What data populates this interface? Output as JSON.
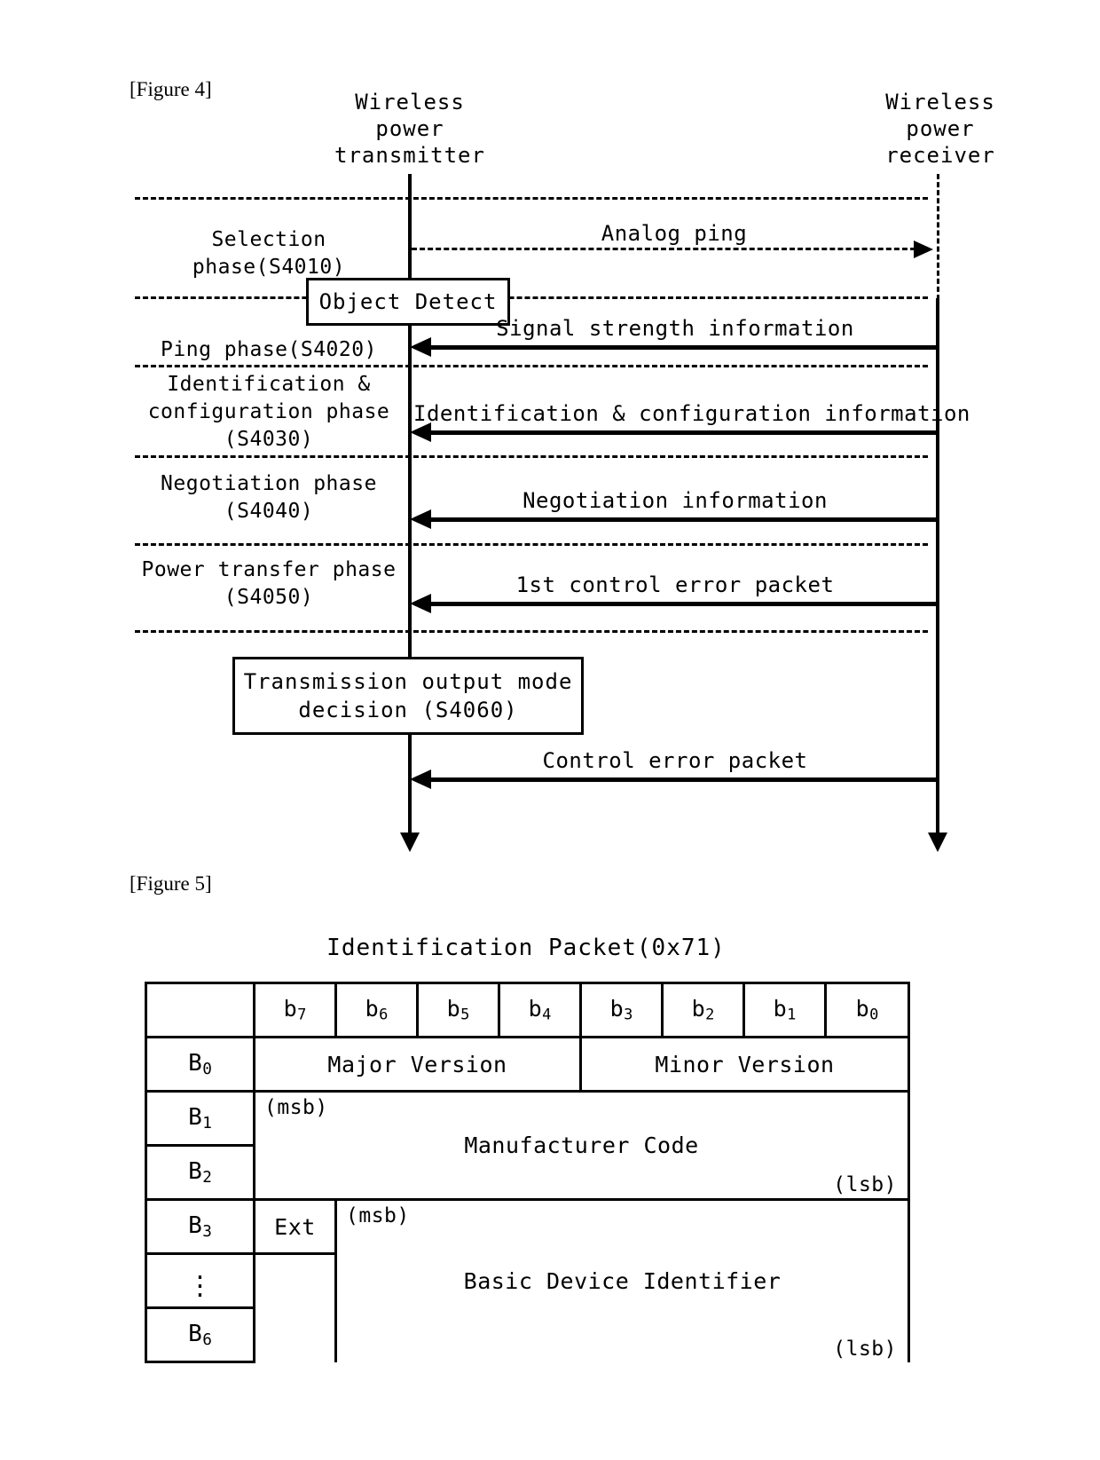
{
  "figure4": {
    "caption": "[Figure 4]",
    "actors": {
      "transmitter": "Wireless\npower\ntransmitter",
      "receiver": "Wireless\npower\nreceiver"
    },
    "phases": [
      {
        "id": "s4010",
        "label": "Selection phase(S4010)"
      },
      {
        "id": "s4020",
        "label": "Ping phase(S4020)"
      },
      {
        "id": "s4030",
        "label": "Identification &\nconfiguration phase\n(S4030)"
      },
      {
        "id": "s4040",
        "label": "Negotiation phase\n(S4040)"
      },
      {
        "id": "s4050",
        "label": "Power transfer phase\n(S4050)"
      }
    ],
    "messages": [
      {
        "id": "analog-ping",
        "label": "Analog ping",
        "direction": "right",
        "style": "dashed"
      },
      {
        "id": "signal-strength",
        "label": "Signal strength information",
        "direction": "left",
        "style": "solid"
      },
      {
        "id": "ident-config",
        "label": "Identification & configuration information",
        "direction": "left",
        "style": "solid"
      },
      {
        "id": "negotiation",
        "label": "Negotiation information",
        "direction": "left",
        "style": "solid"
      },
      {
        "id": "first-control-error",
        "label": "1st control error packet",
        "direction": "left",
        "style": "solid"
      },
      {
        "id": "control-error",
        "label": "Control error packet",
        "direction": "left",
        "style": "solid"
      }
    ],
    "process_boxes": [
      {
        "id": "object-detect",
        "label": "Object Detect"
      },
      {
        "id": "output-mode-decision",
        "label": "Transmission output mode\ndecision (S4060)"
      }
    ]
  },
  "figure5": {
    "caption": "[Figure 5]",
    "title": "Identification Packet(0x71)",
    "table": {
      "bit_headers": [
        "b7",
        "b6",
        "b5",
        "b4",
        "b3",
        "b2",
        "b1",
        "b0"
      ],
      "byte_labels": [
        "B0",
        "B1",
        "B2",
        "B3",
        "⋮",
        "B6"
      ],
      "fields": [
        {
          "id": "major-version",
          "label": "Major Version"
        },
        {
          "id": "minor-version",
          "label": "Minor Version"
        },
        {
          "id": "manufacturer-code",
          "label": "Manufacturer Code",
          "msb": "(msb)",
          "lsb": "(lsb)"
        },
        {
          "id": "ext-bit",
          "label": "Ext"
        },
        {
          "id": "basic-device-identifier",
          "label": "Basic Device Identifier",
          "msb": "(msb)",
          "lsb": "(lsb)"
        }
      ]
    }
  }
}
